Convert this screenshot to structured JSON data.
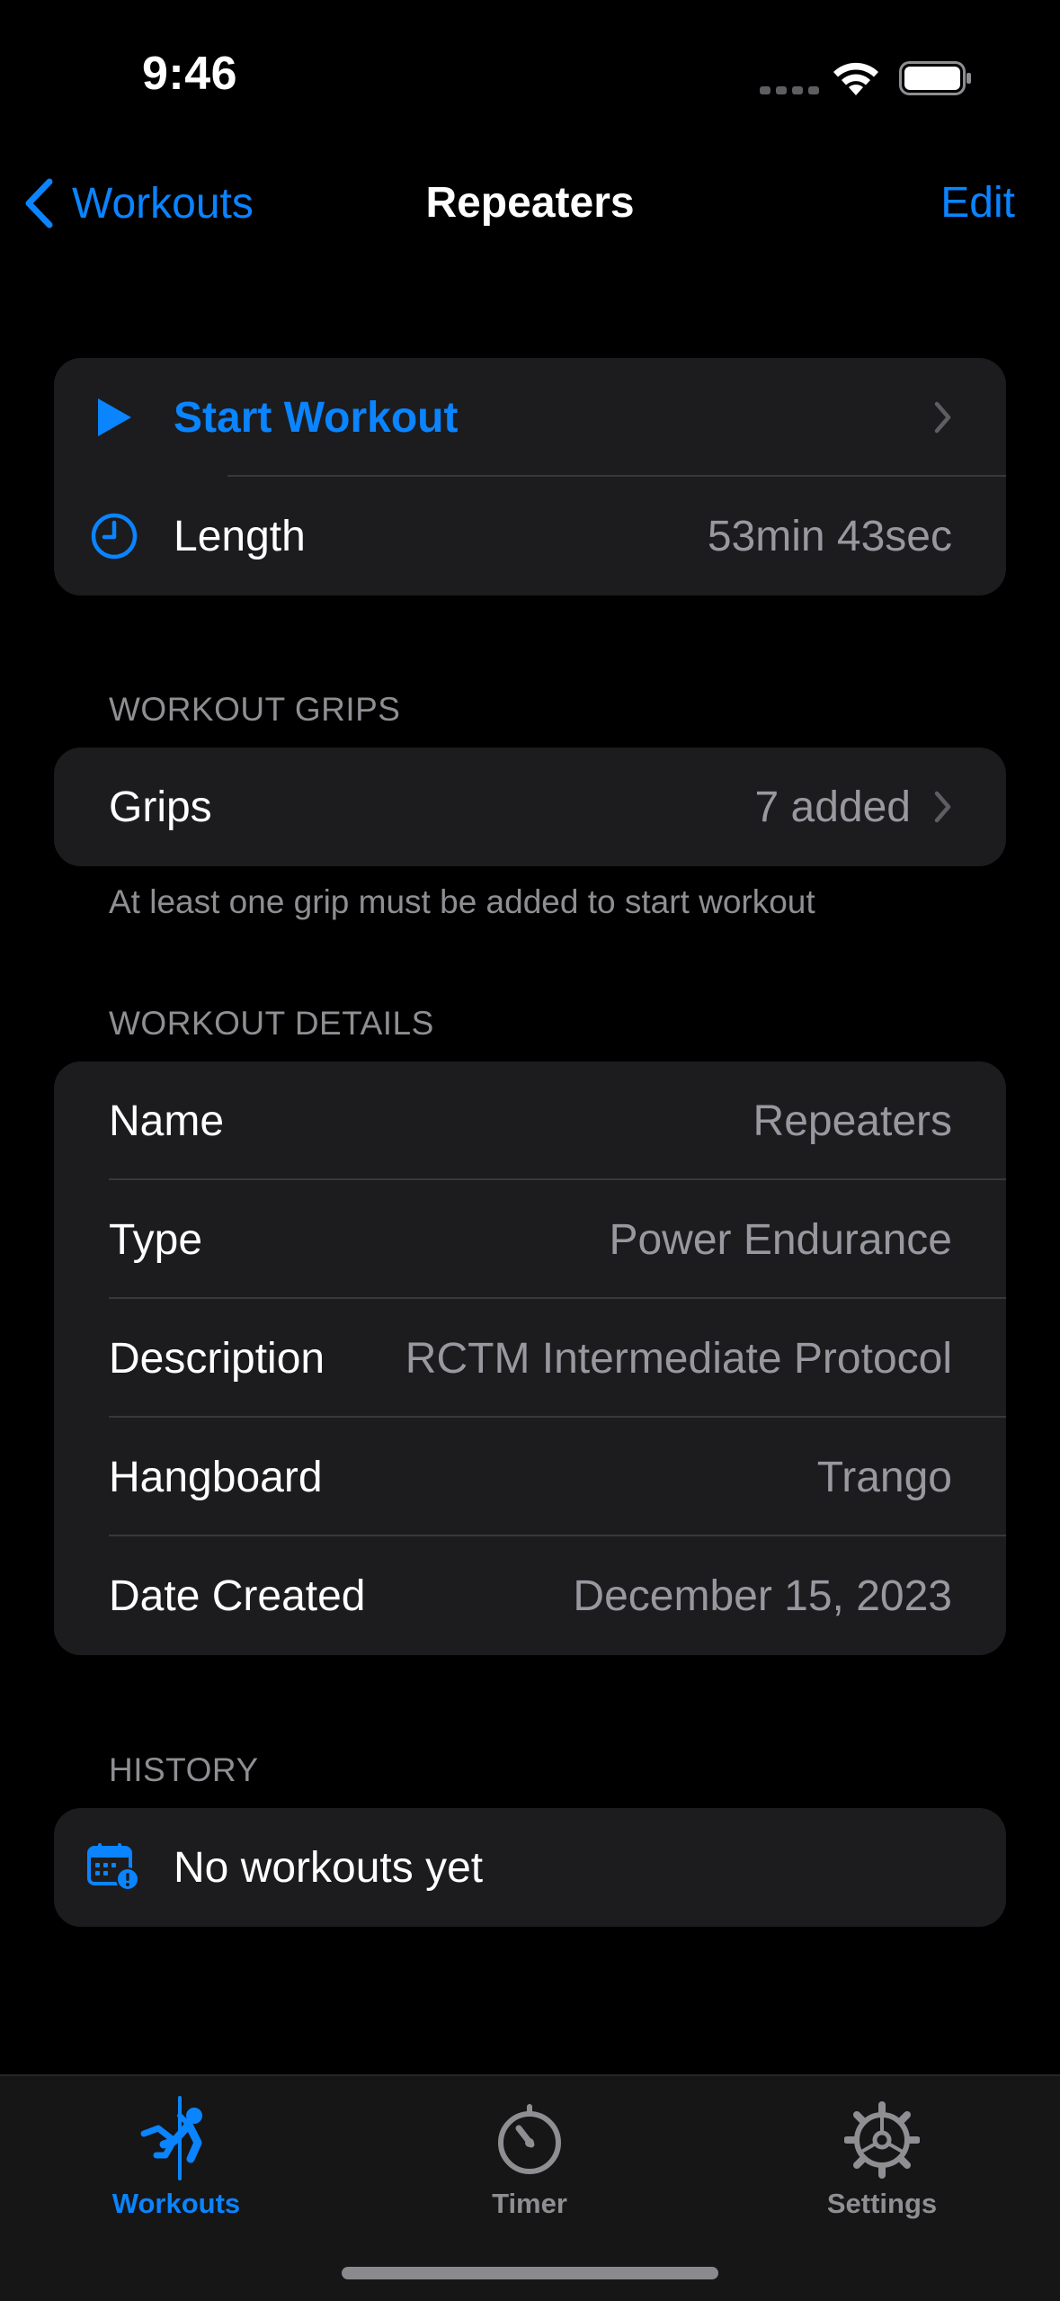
{
  "status_bar": {
    "time": "9:46"
  },
  "nav": {
    "back_label": "Workouts",
    "title": "Repeaters",
    "edit_label": "Edit"
  },
  "summary": {
    "start_label": "Start Workout",
    "length_label": "Length",
    "length_value": "53min 43sec"
  },
  "grips_section": {
    "header": "WORKOUT GRIPS",
    "row_label": "Grips",
    "row_value": "7 added",
    "footer": "At least one grip must be added to start workout"
  },
  "details_section": {
    "header": "WORKOUT DETAILS",
    "rows": [
      {
        "label": "Name",
        "value": "Repeaters"
      },
      {
        "label": "Type",
        "value": "Power Endurance"
      },
      {
        "label": "Description",
        "value": "RCTM Intermediate Protocol"
      },
      {
        "label": "Hangboard",
        "value": "Trango"
      },
      {
        "label": "Date Created",
        "value": "December 15, 2023"
      }
    ]
  },
  "history_section": {
    "header": "HISTORY",
    "empty_label": "No workouts yet"
  },
  "tab_bar": {
    "tabs": [
      {
        "label": "Workouts",
        "icon": "climber-icon",
        "selected": true
      },
      {
        "label": "Timer",
        "icon": "timer-icon",
        "selected": false
      },
      {
        "label": "Settings",
        "icon": "gear-icon",
        "selected": false
      }
    ]
  },
  "colors": {
    "accent": "#0a84ff",
    "type_highlight": "#ff9f3a",
    "background": "#000000",
    "card": "#1c1c1e",
    "secondary_text": "#98989f"
  }
}
